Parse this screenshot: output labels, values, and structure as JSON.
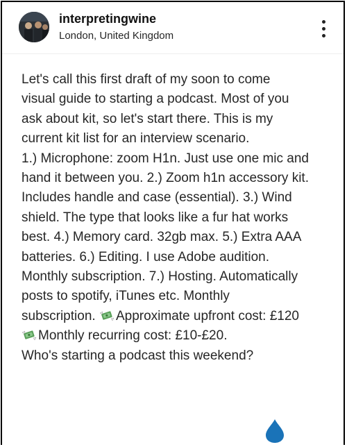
{
  "post": {
    "username": "interpretingwine",
    "location": "London, United Kingdom",
    "caption_lines": [
      "Let's call this first draft of my soon to come",
      "visual guide to starting a podcast. Most of you",
      "ask about kit, so let's start there. This is my",
      "current kit list for an interview scenario.",
      "1.) Microphone: zoom H1n. Just use one mic and",
      "hand it between you. 2.) Zoom h1n accessory kit.",
      "Includes handle and case (essential). 3.) Wind",
      "shield. The type that looks like a fur hat works",
      "best. 4.) Memory card. 32gb max. 5.) Extra AAA",
      "batteries. 6.) Editing. I use Adobe audition.",
      "Monthly subscription. 7.) Hosting.  Automatically",
      "posts to spotify, iTunes etc. Monthly",
      "subscription. ",
      "Approximate upfront cost: £120",
      "Monthly recurring cost: £10-£20.",
      "Who's starting a podcast this weekend?"
    ]
  },
  "icons": {
    "more": "more-options-icon",
    "money": "money-with-wings-icon",
    "drop": "droplet-icon"
  },
  "colors": {
    "text": "#262626",
    "border": "#000000",
    "drop": "#1a73b8",
    "money_green": "#5aa05a"
  }
}
